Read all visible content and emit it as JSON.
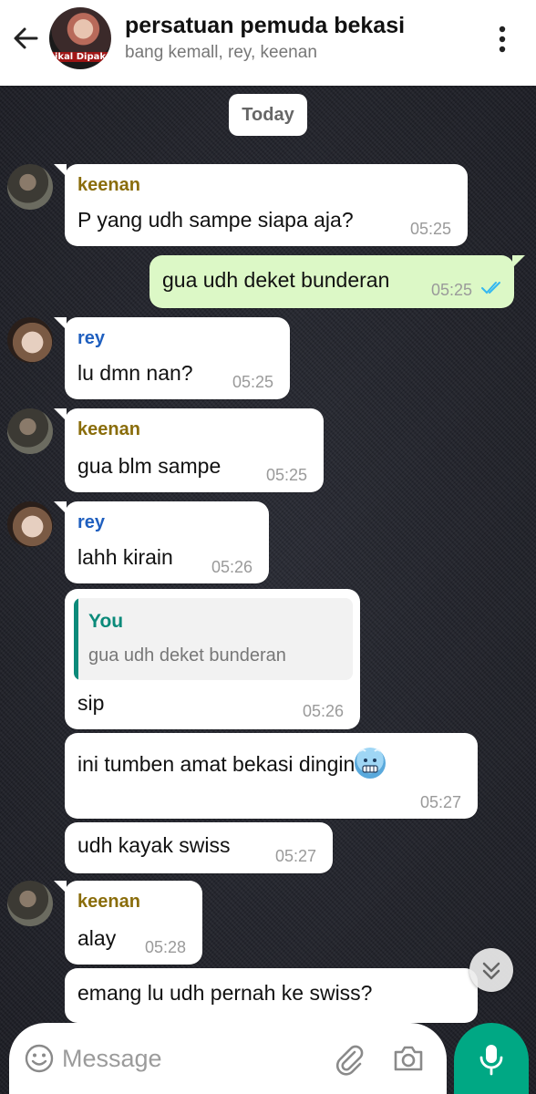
{
  "header": {
    "title": "persatuan pemuda bekasi",
    "subtitle": "bang kemall, rey, keenan",
    "avatar_caption": "ikal Dipak",
    "back_icon": "arrow-left-icon",
    "menu_icon": "more-vertical-icon"
  },
  "date_chip": "Today",
  "messages": [
    {
      "sender": "keenan",
      "text": "P yang udh sampe siapa aja?",
      "time": "05:25",
      "direction": "in"
    },
    {
      "text": "gua udh deket bunderan",
      "time": "05:25",
      "direction": "out",
      "status": "read",
      "status_icon": "double-check-icon"
    },
    {
      "sender": "rey",
      "text": "lu dmn nan?",
      "time": "05:25",
      "direction": "in"
    },
    {
      "sender": "keenan",
      "text": "gua blm sampe",
      "time": "05:25",
      "direction": "in"
    },
    {
      "sender": "rey",
      "text": "lahh kirain",
      "time": "05:26",
      "direction": "in"
    },
    {
      "reply": {
        "name": "You",
        "text": "gua udh deket bunderan"
      },
      "text": "sip",
      "time": "05:26",
      "direction": "in"
    },
    {
      "text": "ini tumben amat bekasi dingin",
      "emoji": "cold-face-emoji",
      "time": "05:27",
      "direction": "in"
    },
    {
      "text": "udh kayak swiss",
      "time": "05:27",
      "direction": "in"
    },
    {
      "sender": "keenan",
      "text": "alay",
      "time": "05:28",
      "direction": "in"
    },
    {
      "text": "emang lu udh pernah ke swiss?",
      "direction": "in"
    }
  ],
  "input": {
    "placeholder": "Message",
    "emoji_icon": "smiley-icon",
    "attach_icon": "paperclip-icon",
    "camera_icon": "camera-icon",
    "mic_icon": "microphone-icon"
  },
  "colors": {
    "accent": "#00a884",
    "outgoing_bubble": "#dcf8c6",
    "incoming_bubble": "#ffffff",
    "read_tick": "#34b7f1",
    "sender_keenan": "#8a6d0b",
    "sender_rey": "#1f5fbf",
    "reply_accent": "#0b8a7a"
  }
}
